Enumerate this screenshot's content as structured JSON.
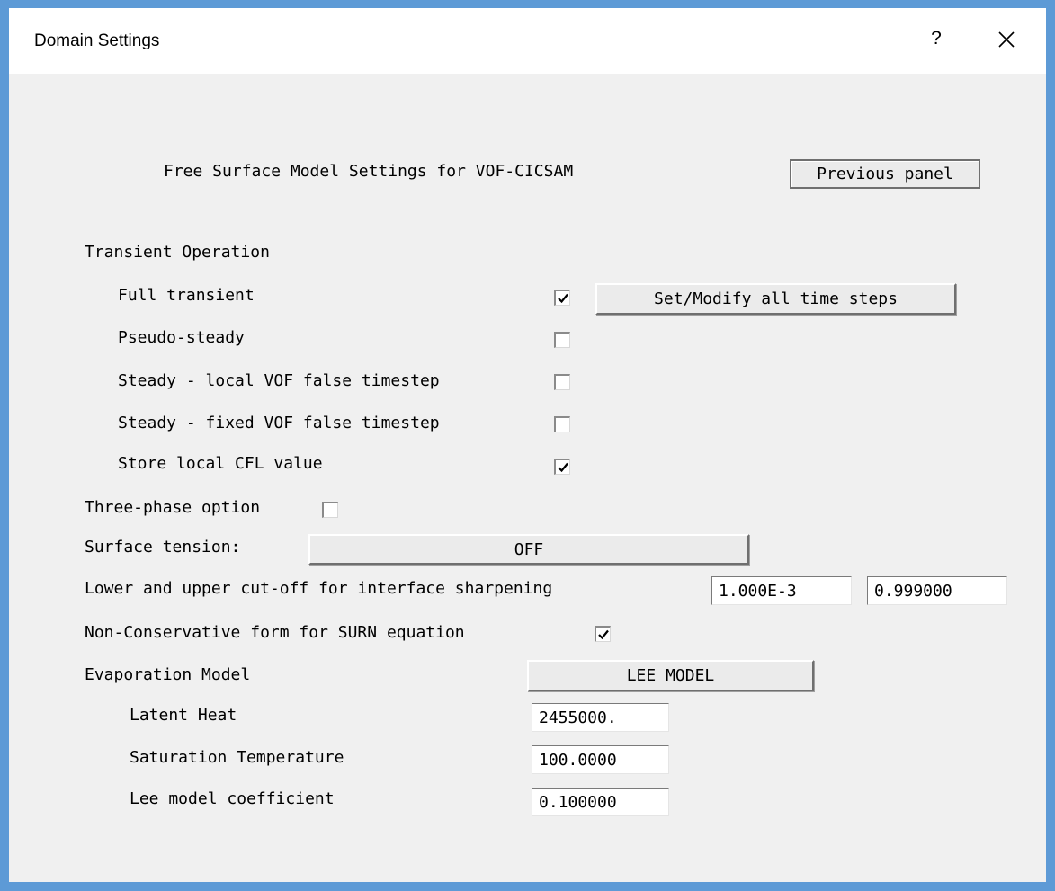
{
  "window": {
    "title": "Domain Settings",
    "help_label": "?"
  },
  "panel": {
    "heading": "Free Surface Model Settings for VOF-CICSAM",
    "previous_button": "Previous panel"
  },
  "transient": {
    "label": "Transient Operation",
    "full_transient": {
      "label": "Full transient",
      "checked": true
    },
    "set_time_steps_button": "Set/Modify all time steps",
    "pseudo_steady": {
      "label": "Pseudo-steady",
      "checked": false
    },
    "steady_local": {
      "label": "Steady - local VOF false timestep",
      "checked": false
    },
    "steady_fixed": {
      "label": "Steady - fixed VOF false timestep",
      "checked": false
    },
    "store_cfl": {
      "label": "Store local CFL value",
      "checked": true
    }
  },
  "three_phase": {
    "label": "Three-phase option",
    "checked": false
  },
  "surface_tension": {
    "label": "Surface tension:",
    "value": "OFF"
  },
  "cutoff": {
    "label": "Lower and upper cut-off for interface sharpening",
    "lower": "1.000E-3",
    "upper": "0.999000"
  },
  "non_conservative": {
    "label": "Non-Conservative form for SURN equation",
    "checked": true
  },
  "evaporation": {
    "label": "Evaporation Model",
    "model": "LEE MODEL",
    "latent_heat": {
      "label": "Latent Heat",
      "value": "2455000."
    },
    "saturation_temperature": {
      "label": "Saturation Temperature",
      "value": "100.0000"
    },
    "lee_coefficient": {
      "label": "Lee model coefficient",
      "value": "0.100000"
    }
  }
}
